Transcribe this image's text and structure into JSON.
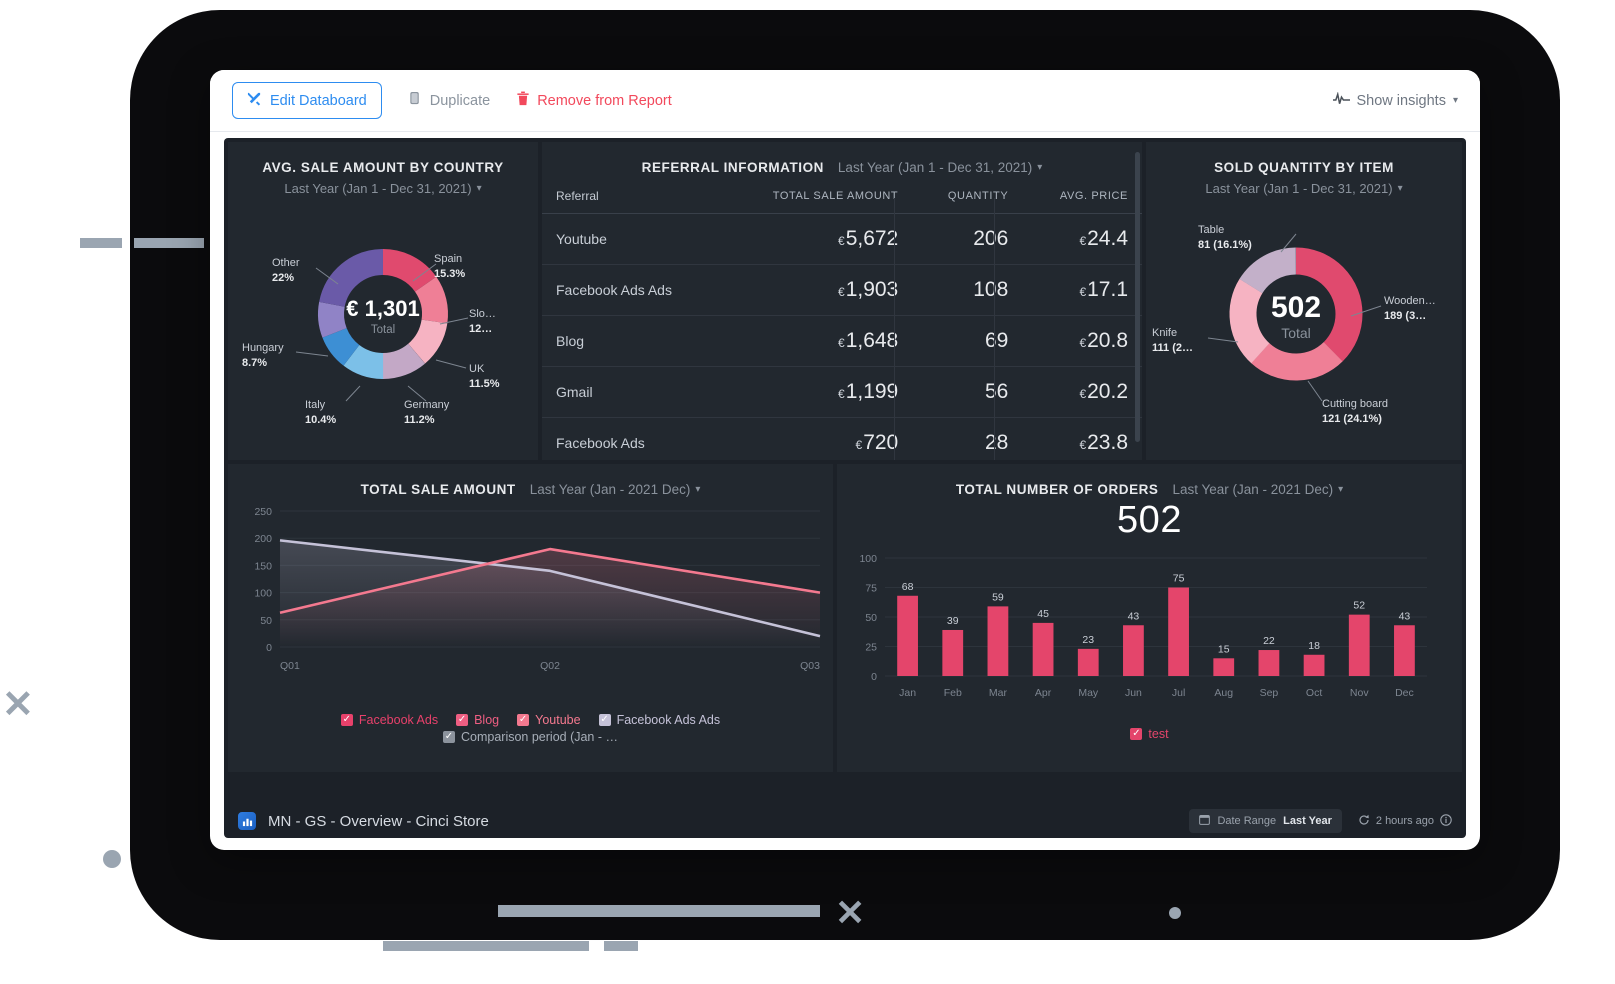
{
  "toolbar": {
    "edit_label": "Edit Databoard",
    "duplicate_label": "Duplicate",
    "remove_label": "Remove from Report",
    "insights_label": "Show insights",
    "edit_icon": "tools-icon",
    "duplicate_icon": "copy-icon",
    "remove_icon": "trash-icon",
    "insights_icon": "pulse-icon",
    "chevron": "⌄"
  },
  "panels": {
    "country": {
      "title": "AVG. SALE AMOUNT BY COUNTRY",
      "date_range": "Last Year (Jan 1 - Dec 31, 2021)",
      "center_value": "€ 1,301",
      "center_label": "Total"
    },
    "referral": {
      "title": "REFERRAL INFORMATION",
      "date_range": "Last Year (Jan 1 - Dec 31, 2021)",
      "columns": [
        "Referral",
        "TOTAL SALE AMOUNT",
        "QUANTITY",
        "AVG. PRICE"
      ],
      "rows": [
        {
          "referral": "Youtube",
          "total": "5,672",
          "quantity": "206",
          "avg": "24.4",
          "currency": "€"
        },
        {
          "referral": "Facebook Ads Ads",
          "total": "1,903",
          "quantity": "108",
          "avg": "17.1",
          "currency": "€"
        },
        {
          "referral": "Blog",
          "total": "1,648",
          "quantity": "69",
          "avg": "20.8",
          "currency": "€"
        },
        {
          "referral": "Gmail",
          "total": "1,199",
          "quantity": "56",
          "avg": "20.2",
          "currency": "€"
        },
        {
          "referral": "Facebook Ads",
          "total": "720",
          "quantity": "28",
          "avg": "23.8",
          "currency": "€"
        }
      ]
    },
    "items": {
      "title": "SOLD QUANTITY BY ITEM",
      "date_range": "Last Year (Jan 1 - Dec 31, 2021)",
      "center_value": "502",
      "center_label": "Total"
    },
    "sales": {
      "title": "TOTAL SALE AMOUNT",
      "date_range": "Last Year (Jan - 2021 Dec)"
    },
    "orders": {
      "title": "TOTAL NUMBER OF ORDERS",
      "date_range": "Last Year (Jan - 2021 Dec)",
      "big_number": "502"
    }
  },
  "footer": {
    "title": "MN - GS - Overview - Cinci Store",
    "logo_icon": "databox-logo-icon",
    "date_range_icon": "calendar-icon",
    "date_range_label": "Date Range",
    "date_range_value": "Last Year",
    "refresh_icon": "refresh-icon",
    "refresh_text": "2 hours ago",
    "info_icon": "info-icon"
  },
  "chart_data": [
    {
      "type": "pie",
      "title": "AVG. SALE AMOUNT BY COUNTRY",
      "center_total": "€ 1,301",
      "legend_position": "outside-labels",
      "slices": [
        {
          "label": "Spain",
          "value": 15.3,
          "display": "15.3%",
          "color": "#e04a6e"
        },
        {
          "label": "Slo…",
          "value": 12.0,
          "display": "12…",
          "color": "#ef7f96"
        },
        {
          "label": "UK",
          "value": 11.5,
          "display": "11.5%",
          "color": "#f6b3c2"
        },
        {
          "label": "Germany",
          "value": 11.2,
          "display": "11.2%",
          "color": "#c3a8c6"
        },
        {
          "label": "Italy",
          "value": 10.4,
          "display": "10.4%",
          "color": "#7cc0e8"
        },
        {
          "label": "Hungary",
          "value": 8.7,
          "display": "8.7%",
          "color": "#3d8fd4"
        },
        {
          "label": "Other",
          "value": 22.0,
          "display": "22%",
          "color": "#6a5aa8"
        },
        {
          "label": "",
          "value": 8.9,
          "display": "",
          "color": "#9083c6"
        }
      ]
    },
    {
      "type": "pie",
      "title": "SOLD QUANTITY BY ITEM",
      "center_total": "502",
      "legend_position": "outside-labels",
      "slices": [
        {
          "label": "Wooden…",
          "value": 189,
          "display": "189 (3…",
          "color": "#e04a6e"
        },
        {
          "label": "Cutting board",
          "value": 121,
          "display": "121 (24.1%)",
          "color": "#ef7f96"
        },
        {
          "label": "Knife",
          "value": 111,
          "display": "111 (2…",
          "color": "#f6b3c2"
        },
        {
          "label": "Table",
          "value": 81,
          "display": "81 (16.1%)",
          "color": "#c3b0c9"
        }
      ]
    },
    {
      "type": "line",
      "title": "TOTAL SALE AMOUNT",
      "xlabel": "",
      "ylabel": "",
      "categories": [
        "Q01",
        "Q02",
        "Q03"
      ],
      "yticks": [
        0,
        50,
        100,
        150,
        200,
        250
      ],
      "ylim": [
        0,
        250
      ],
      "grid": true,
      "series": [
        {
          "name": "Youtube",
          "values": [
            63,
            180,
            100
          ],
          "color": "#f4798f"
        },
        {
          "name": "Facebook Ads Ads",
          "values": [
            196,
            140,
            20
          ],
          "color": "#c5c2d8"
        }
      ],
      "legend": [
        {
          "label": "Facebook Ads",
          "color": "#e8416b",
          "checked": true
        },
        {
          "label": "Blog",
          "color": "#ee5e82",
          "checked": true
        },
        {
          "label": "Youtube",
          "color": "#f4798f",
          "checked": true
        },
        {
          "label": "Facebook Ads Ads",
          "color": "#c5c2d8",
          "checked": true
        },
        {
          "label": "Comparison period (Jan - …",
          "color": "#8c939d",
          "checked": true
        }
      ]
    },
    {
      "type": "bar",
      "title": "TOTAL NUMBER OF ORDERS",
      "big_number": "502",
      "categories": [
        "Jan",
        "Feb",
        "Mar",
        "Apr",
        "May",
        "Jun",
        "Jul",
        "Aug",
        "Sep",
        "Oct",
        "Nov",
        "Dec"
      ],
      "values": [
        68,
        39,
        59,
        45,
        23,
        43,
        75,
        15,
        22,
        18,
        52,
        43
      ],
      "yticks": [
        0,
        25,
        50,
        75,
        100
      ],
      "ylim": [
        0,
        100
      ],
      "grid": true,
      "series_color": "#e4456b",
      "legend": [
        {
          "label": "test",
          "color": "#e4456b",
          "checked": true
        }
      ]
    }
  ]
}
